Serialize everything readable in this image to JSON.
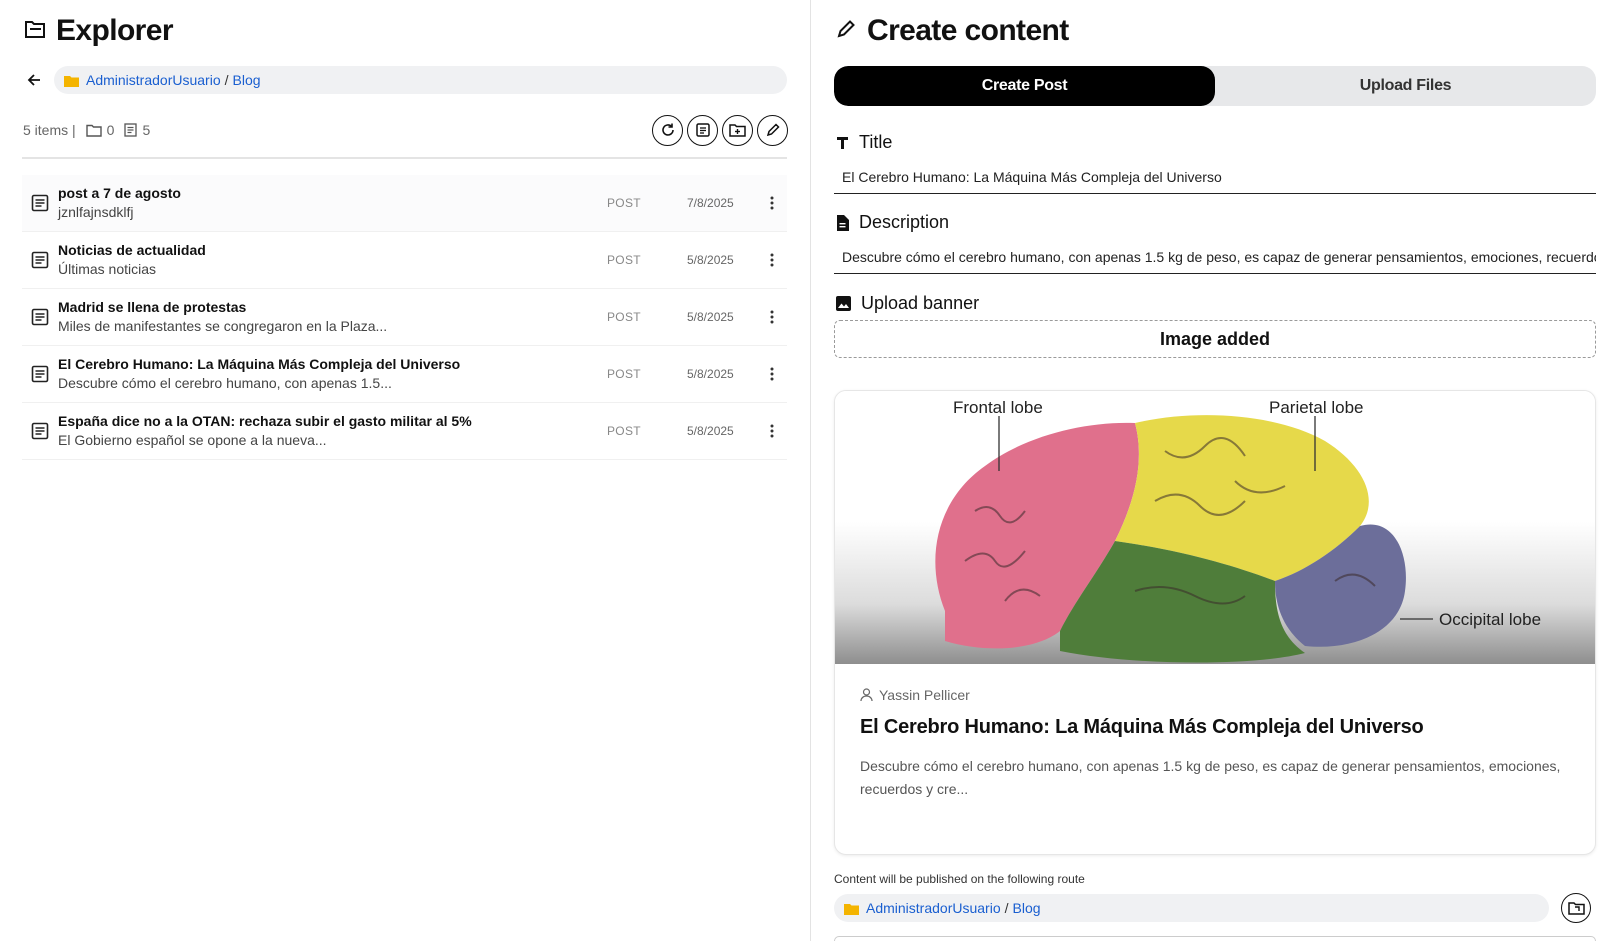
{
  "explorer": {
    "title": "Explorer",
    "icon": "folder-open-icon",
    "breadcrumb": [
      "AdministradorUsuario",
      "Blog"
    ],
    "breadcrumb_sep": "/",
    "stats": {
      "items_label": "5 items |",
      "folders": "0",
      "files": "5"
    },
    "toolbar": [
      "refresh-icon",
      "new-post-icon",
      "new-folder-icon",
      "edit-icon"
    ],
    "rows": [
      {
        "title": "post a 7 de agosto",
        "desc": "jznlfajnsdklfj",
        "type": "POST",
        "date": "7/8/2025"
      },
      {
        "title": "Noticias de actualidad",
        "desc": "Últimas noticias",
        "type": "POST",
        "date": "5/8/2025"
      },
      {
        "title": "Madrid se llena de protestas",
        "desc": "Miles de manifestantes se congregaron en la Plaza...",
        "type": "POST",
        "date": "5/8/2025"
      },
      {
        "title": "El Cerebro Humano: La Máquina Más Compleja del Universo",
        "desc": "Descubre cómo el cerebro humano, con apenas 1.5...",
        "type": "POST",
        "date": "5/8/2025"
      },
      {
        "title": "España dice no a la OTAN: rechaza subir el gasto militar al 5%",
        "desc": "El Gobierno español se opone a la nueva...",
        "type": "POST",
        "date": "5/8/2025"
      }
    ]
  },
  "create": {
    "title": "Create content",
    "tabs": {
      "create_post": "Create Post",
      "upload_files": "Upload Files"
    },
    "fields": {
      "title_label": "Title",
      "title_value": "El Cerebro Humano: La Máquina Más Compleja del Universo",
      "description_label": "Description",
      "description_value": "Descubre cómo el cerebro humano, con apenas 1.5 kg de peso, es capaz de generar pensamientos, emociones, recuerdos y cre",
      "banner_label": "Upload banner",
      "banner_status": "Image added"
    },
    "preview": {
      "labels": {
        "frontal": "Frontal lobe",
        "parietal": "Parietal lobe",
        "occipital": "Occipital lobe"
      },
      "author": "Yassin Pellicer",
      "title": "El Cerebro Humano: La Máquina Más Compleja del Universo",
      "desc": "Descubre cómo el cerebro humano, con apenas 1.5 kg de peso, es capaz de generar pensamientos, emociones, recuerdos y cre..."
    },
    "route_caption": "Content will be published on the following route",
    "route": [
      "AdministradorUsuario",
      "Blog"
    ]
  },
  "colors": {
    "link": "#1a5fd0",
    "folder": "#f4b400",
    "active_tab": "#000000"
  }
}
